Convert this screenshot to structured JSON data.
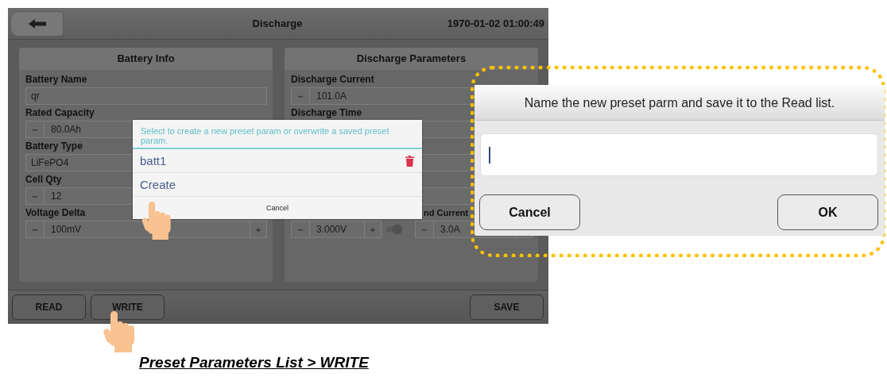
{
  "screen": {
    "title": "Discharge",
    "datetime": "1970-01-02 01:00:49",
    "panels": [
      {
        "title": "Battery Info",
        "fields": [
          {
            "kind": "text",
            "label": "Battery Name",
            "value": "qr"
          },
          {
            "kind": "stepper",
            "label": "Rated Capacity",
            "value": "80.0Ah"
          },
          {
            "kind": "text",
            "label": "Battery Type",
            "value": "LiFePO4"
          },
          {
            "kind": "stepper",
            "label": "Cell Qty",
            "value": "12"
          },
          {
            "kind": "stepper",
            "label": "Voltage Delta",
            "value": "100mV"
          }
        ]
      },
      {
        "title": "Discharge Parameters",
        "fields": [
          {
            "kind": "stepper",
            "label": "Discharge Current",
            "value": "101.0A"
          },
          {
            "kind": "stepper",
            "label": "Discharge Time"
          },
          {
            "kind": "stepper"
          },
          {
            "kind": "stepper"
          },
          {
            "kind": "pair",
            "items": [
              {
                "kind": "stepper",
                "value": "3.000V",
                "toggle": true
              },
              {
                "kind": "stepper",
                "label": "nd Current",
                "value": "3.0A"
              }
            ]
          }
        ]
      }
    ],
    "toolbar": {
      "left_buttons": [
        "READ",
        "WRITE"
      ],
      "right_buttons": [
        "SAVE"
      ]
    }
  },
  "preset_dialog": {
    "message": "Select to create a new preset param or overwrite a saved preset param.",
    "items": [
      {
        "label": "batt1",
        "deletable": true
      },
      {
        "label": "Create",
        "deletable": false
      }
    ],
    "cancel": "Cancel"
  },
  "name_dialog": {
    "message": "Name the new preset parm and save it to the Read list.",
    "buttons": [
      "Cancel",
      "OK"
    ]
  },
  "caption": "Preset Parameters List > WRITE"
}
